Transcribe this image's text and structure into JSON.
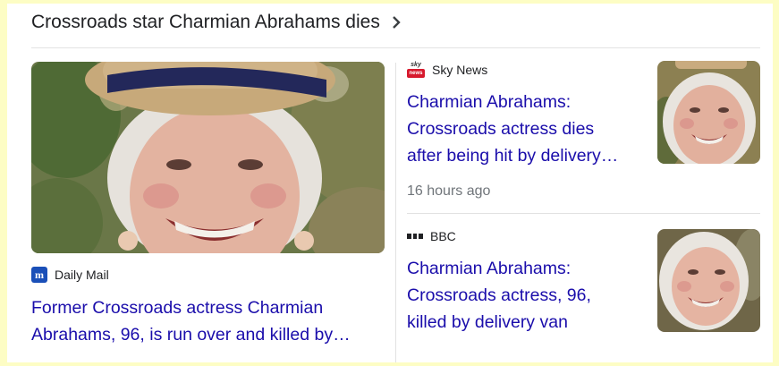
{
  "header": {
    "title": "Crossroads star Charmian Abrahams dies"
  },
  "lead": {
    "source": "Daily Mail",
    "source_icon": "daily-mail-logo-icon",
    "headline_line1": "Former Crossroads actress Charmian",
    "headline_line2": "Abrahams, 96, is run over and killed by…"
  },
  "stories": [
    {
      "source": "Sky News",
      "source_icon": "sky-news-logo-icon",
      "headline_line1": "Charmian Abrahams:",
      "headline_line2": "Crossroads actress dies",
      "headline_line3": "after being hit by delivery…",
      "time": "16 hours ago"
    },
    {
      "source": "BBC",
      "source_icon": "bbc-logo-icon",
      "headline_line1": "Charmian Abrahams:",
      "headline_line2": "Crossroads actress, 96,",
      "headline_line3": "killed by delivery van"
    }
  ],
  "colors": {
    "link": "#1a0dab",
    "page_bg": "#fdfdc4",
    "text": "#202124",
    "muted": "#70757a"
  }
}
